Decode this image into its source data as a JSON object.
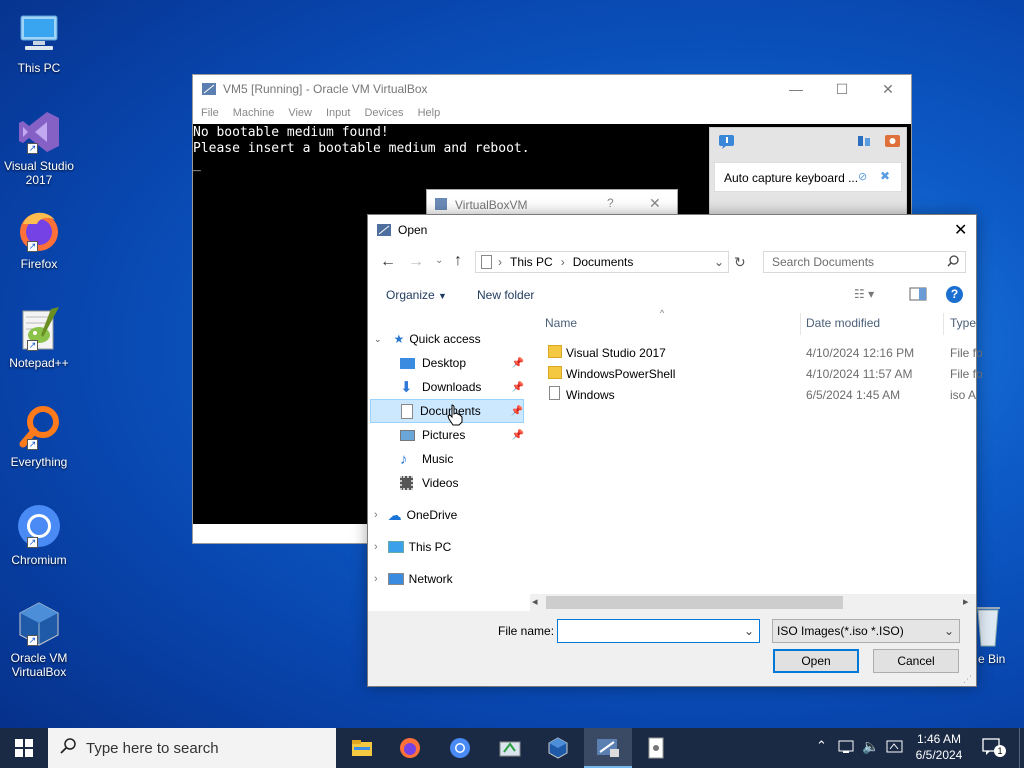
{
  "desktop": {
    "icons": [
      {
        "label": "This PC"
      },
      {
        "label": "Visual Studio 2017"
      },
      {
        "label": "Firefox"
      },
      {
        "label": "Notepad++"
      },
      {
        "label": "Everything"
      },
      {
        "label": "Chromium"
      },
      {
        "label": "Oracle VM VirtualBox"
      },
      {
        "label": "e Bin"
      }
    ]
  },
  "vbox": {
    "title": "VM5 [Running] - Oracle VM VirtualBox",
    "menu": [
      "File",
      "Machine",
      "View",
      "Input",
      "Devices",
      "Help"
    ],
    "console": [
      "No bootable medium found!",
      "Please insert a bootable medium and reboot.",
      "_"
    ],
    "notice_text": "Auto capture keyboard ...",
    "sub_title": "VirtualBoxVM",
    "sub_help": "?"
  },
  "dialog": {
    "title": "Open",
    "address": [
      "This PC",
      "Documents"
    ],
    "search_placeholder": "Search Documents",
    "organize": "Organize",
    "new_folder": "New folder",
    "nav": {
      "quick_access": "Quick access",
      "items": [
        "Desktop",
        "Downloads",
        "Documents",
        "Pictures",
        "Music",
        "Videos"
      ],
      "onedrive": "OneDrive",
      "this_pc": "This PC",
      "network": "Network"
    },
    "columns": {
      "name": "Name",
      "date": "Date modified",
      "type": "Type"
    },
    "files": [
      {
        "name": "Visual Studio 2017",
        "date": "4/10/2024 12:16 PM",
        "type": "File fo"
      },
      {
        "name": "WindowsPowerShell",
        "date": "4/10/2024 11:57 AM",
        "type": "File fo"
      },
      {
        "name": "Windows",
        "date": "6/5/2024 1:45 AM",
        "type": "iso A"
      }
    ],
    "filename_label": "File name:",
    "filename_value": "",
    "filter": "ISO Images(*.iso *.ISO)",
    "open_button": "Open",
    "cancel_button": "Cancel"
  },
  "taskbar": {
    "search_placeholder": "Type here to search",
    "time": "1:46 AM",
    "date": "6/5/2024",
    "notification_count": "1"
  },
  "colors": {
    "accent": "#0078d7",
    "selected_bg": "#cce8ff",
    "taskbar": "#1a2a44"
  }
}
